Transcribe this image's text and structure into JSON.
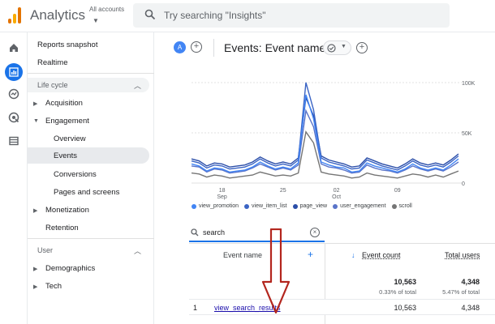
{
  "header": {
    "app_title": "Analytics",
    "account_label": "All accounts",
    "search_placeholder": "Try searching \"Insights\""
  },
  "colors": {
    "accent": "#1a73e8",
    "logo_orange": "#f9ab00",
    "logo_dark": "#e37400"
  },
  "rail": {
    "icons": [
      "home-icon",
      "reports-icon",
      "explore-icon",
      "advertising-icon",
      "configure-icon"
    ]
  },
  "nav": {
    "reports_snapshot": "Reports snapshot",
    "realtime": "Realtime",
    "lifecycle": "Life cycle",
    "acquisition": "Acquisition",
    "engagement": "Engagement",
    "overview": "Overview",
    "events": "Events",
    "conversions": "Conversions",
    "pages_and_screens": "Pages and screens",
    "monetization": "Monetization",
    "retention": "Retention",
    "user": "User",
    "demographics": "Demographics",
    "tech": "Tech"
  },
  "page": {
    "avatar_letter": "A",
    "title": "Events: Event name"
  },
  "chart_data": {
    "type": "line",
    "x_tick_labels": [
      {
        "day": "18",
        "month": "Sep"
      },
      {
        "day": "25",
        "month": ""
      },
      {
        "day": "02",
        "month": "Oct"
      },
      {
        "day": "09",
        "month": ""
      }
    ],
    "y_tick_labels": [
      "100K",
      "50K",
      "0"
    ],
    "ylim": [
      0,
      100000
    ],
    "series": [
      {
        "name": "view_promotion",
        "color": "#4285f4",
        "values": [
          19000,
          17000,
          12000,
          15000,
          14000,
          11000,
          12000,
          13000,
          16000,
          21000,
          17000,
          14000,
          16000,
          14000,
          20000,
          88000,
          64000,
          21000,
          18000,
          16000,
          15000,
          11000,
          12000,
          20000,
          17000,
          15000,
          13000,
          11000,
          14000,
          19000,
          15000,
          13000,
          15000,
          13000,
          18000,
          24000
        ]
      },
      {
        "name": "view_item_list",
        "color": "#3b64c4",
        "values": [
          22000,
          20000,
          15000,
          18000,
          17000,
          14000,
          15000,
          16000,
          19000,
          24000,
          20000,
          17000,
          19000,
          17000,
          23000,
          100000,
          73000,
          25000,
          21000,
          19000,
          17000,
          14000,
          15000,
          23000,
          20000,
          17000,
          15000,
          13000,
          17000,
          22000,
          18000,
          16000,
          18000,
          16000,
          21000,
          27000
        ]
      },
      {
        "name": "page_view",
        "color": "#2b4ea8",
        "values": [
          24000,
          22000,
          17000,
          20000,
          19000,
          16000,
          17000,
          18000,
          21000,
          26000,
          22000,
          19000,
          21000,
          19000,
          25000,
          85000,
          67000,
          27000,
          23000,
          21000,
          19000,
          16000,
          17000,
          25000,
          22000,
          19000,
          17000,
          15000,
          19000,
          24000,
          20000,
          18000,
          20000,
          18000,
          23000,
          29000
        ]
      },
      {
        "name": "user_engagement",
        "color": "#5a74c9",
        "values": [
          17000,
          16000,
          11000,
          14000,
          13000,
          10000,
          11000,
          12000,
          15000,
          19000,
          16000,
          13000,
          15000,
          13000,
          18000,
          72000,
          56000,
          19000,
          16000,
          15000,
          13000,
          10000,
          11000,
          18000,
          15000,
          13000,
          12000,
          10000,
          13000,
          17000,
          14000,
          12000,
          14000,
          12000,
          16000,
          21000
        ]
      },
      {
        "name": "scroll",
        "color": "#757575",
        "values": [
          10000,
          9000,
          6000,
          8000,
          7000,
          5000,
          6000,
          7000,
          8000,
          11000,
          9000,
          7000,
          8000,
          7000,
          10000,
          51000,
          40000,
          11000,
          9000,
          8000,
          7000,
          5000,
          6000,
          10000,
          8000,
          7000,
          6000,
          5000,
          7000,
          9000,
          8000,
          6000,
          8000,
          6000,
          9000,
          12000
        ]
      }
    ]
  },
  "table": {
    "search_value": "search",
    "col_event_name": "Event name",
    "col_event_count": "Event count",
    "col_total_users": "Total users",
    "totals": {
      "event_count": "10,563",
      "event_count_pct": "0.33% of total",
      "total_users": "4,348",
      "total_users_pct": "5.47% of total"
    },
    "rows": [
      {
        "index": "1",
        "event_name": "view_search_results",
        "event_count": "10,563",
        "total_users": "4,348"
      }
    ]
  }
}
